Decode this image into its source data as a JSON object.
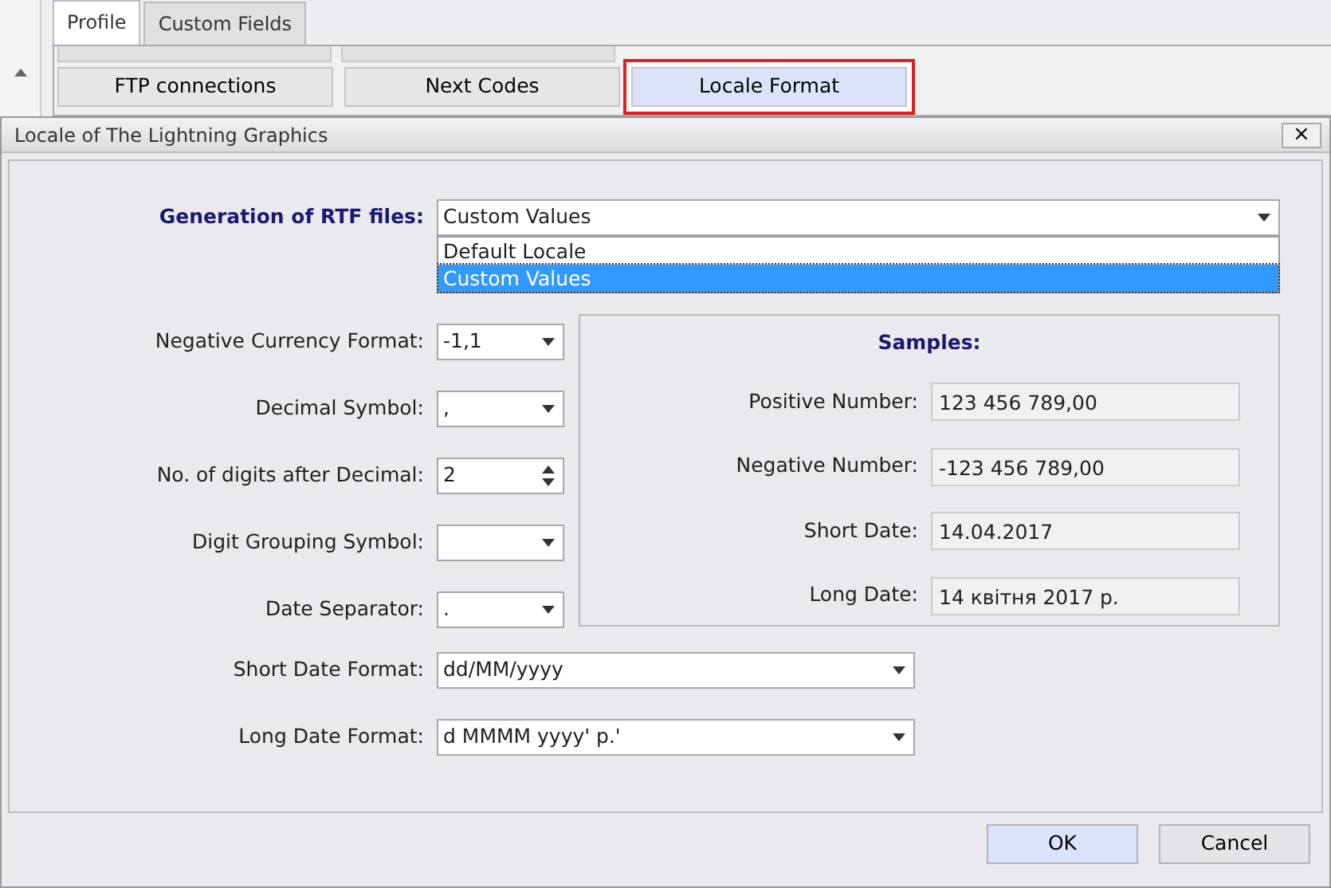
{
  "background": {
    "tabs": [
      {
        "label": "Profile",
        "selected": true
      },
      {
        "label": "Custom Fields",
        "selected": false
      }
    ],
    "buttons": [
      {
        "label": "FTP connections",
        "highlighted": false
      },
      {
        "label": "Next Codes",
        "highlighted": false
      },
      {
        "label": "Locale Format",
        "highlighted": true
      }
    ]
  },
  "dialog": {
    "title": "Locale of The Lightning Graphics",
    "close": "×",
    "generation": {
      "label": "Generation of RTF files:",
      "value": "Custom Values",
      "options": [
        {
          "label": "Default Locale",
          "selected": false
        },
        {
          "label": "Custom Values",
          "selected": true
        }
      ]
    },
    "fields": [
      {
        "kind": "combo",
        "label": "Negative Currency Format:",
        "value": "-1,1"
      },
      {
        "kind": "combo",
        "label": "Decimal Symbol:",
        "value": ","
      },
      {
        "kind": "spin",
        "label": "No. of digits after Decimal:",
        "value": "2"
      },
      {
        "kind": "combo",
        "label": "Digit Grouping Symbol:"
      },
      {
        "kind": "combo",
        "label": "Date Separator:",
        "value": "."
      }
    ],
    "samples": {
      "title": "Samples:",
      "items": [
        {
          "label": "Positive Number:",
          "value": "123 456 789,00"
        },
        {
          "label": "Negative Number:",
          "value": "-123 456 789,00"
        },
        {
          "label": "Short Date:",
          "value": "14.04.2017"
        },
        {
          "label": "Long Date:",
          "value": "14 квітня 2017 р."
        }
      ]
    },
    "format_fields": [
      {
        "label": "Short Date Format:",
        "value": "dd/MM/yyyy"
      },
      {
        "label": "Long Date Format:",
        "value": "d MMMM yyyy' p.'"
      }
    ],
    "buttons": [
      {
        "label": "OK",
        "default": true
      },
      {
        "label": "Cancel",
        "default": false
      }
    ]
  }
}
